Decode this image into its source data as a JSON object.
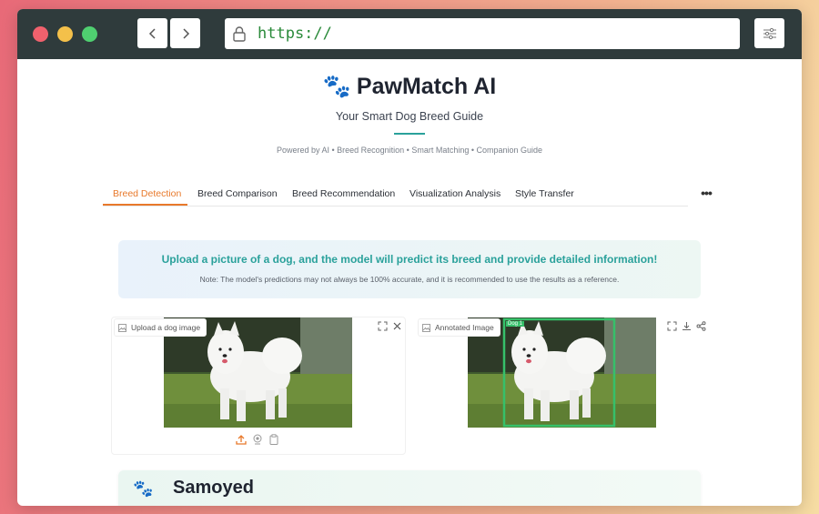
{
  "browser": {
    "url": "https://"
  },
  "app": {
    "title": "PawMatch AI",
    "subtitle": "Your Smart Dog Breed Guide",
    "powered_by": "Powered by AI • Breed Recognition • Smart Matching • Companion Guide"
  },
  "tabs": [
    {
      "label": "Breed Detection",
      "active": true
    },
    {
      "label": "Breed Comparison",
      "active": false
    },
    {
      "label": "Breed Recommendation",
      "active": false
    },
    {
      "label": "Visualization Analysis",
      "active": false
    },
    {
      "label": "Style Transfer",
      "active": false
    }
  ],
  "tabs_more_label": "•••",
  "info": {
    "main": "Upload a picture of a dog, and the model will predict its breed and provide detailed information!",
    "note": "Note: The model's predictions may not always be 100% accurate, and it is recommended to use the results as a reference."
  },
  "upload_panel": {
    "label": "Upload a dog image",
    "icons": [
      "fullscreen-icon",
      "close-icon"
    ],
    "actions": [
      "upload-icon",
      "webcam-icon",
      "clipboard-icon"
    ]
  },
  "annotated_panel": {
    "label": "Annotated Image",
    "icons": [
      "fullscreen-icon",
      "download-icon",
      "share-icon"
    ],
    "bbox_label": "Dog 1"
  },
  "result": {
    "breed": "Samoyed"
  },
  "colors": {
    "accent_orange": "#e8792b",
    "accent_teal": "#2aa19b",
    "url_green": "#2a8a3a",
    "titlebar": "#2f3b3c",
    "bbox_green": "#36c06a"
  }
}
